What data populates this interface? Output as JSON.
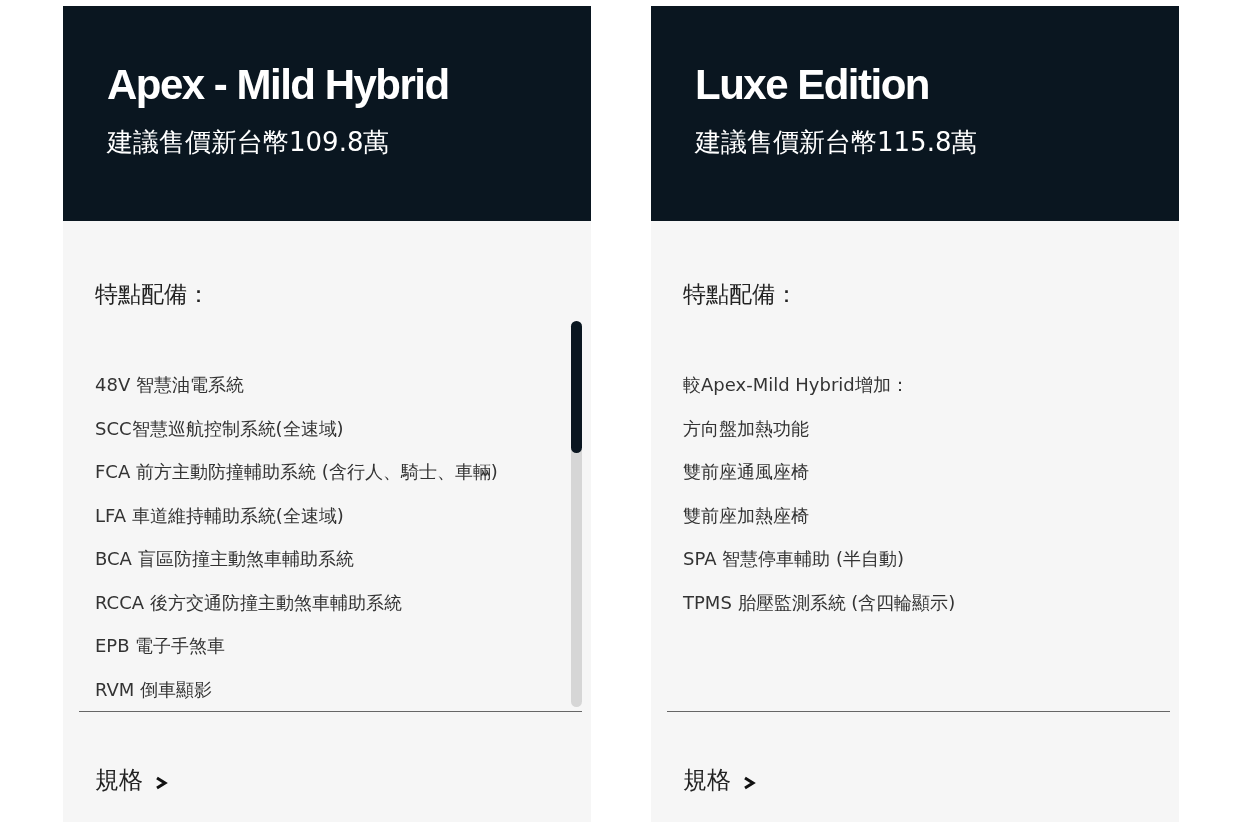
{
  "cards": [
    {
      "title": "Apex - Mild Hybrid",
      "price": "建議售價新台幣109.8萬",
      "features_heading": "特點配備：",
      "scrollable": true,
      "features": [
        "48V 智慧油電系統",
        "SCC智慧巡航控制系統(全速域)",
        "FCA 前方主動防撞輔助系統 (含行人、騎士、車輛)",
        "LFA 車道維持輔助系統(全速域)",
        "BCA 盲區防撞主動煞車輔助系統",
        "RCCA 後方交通防撞主動煞車輔助系統",
        "EPB 電子手煞車",
        "RVM 倒車顯影"
      ],
      "specs_link": "規格"
    },
    {
      "title": "Luxe Edition",
      "price": "建議售價新台幣115.8萬",
      "features_heading": "特點配備：",
      "scrollable": false,
      "features": [
        "較Apex-Mild Hybrid增加：",
        "方向盤加熱功能",
        "雙前座通風座椅",
        "雙前座加熱座椅",
        "SPA 智慧停車輔助 (半自動)",
        "TPMS 胎壓監測系統 (含四輪顯示)"
      ],
      "specs_link": "規格"
    }
  ]
}
